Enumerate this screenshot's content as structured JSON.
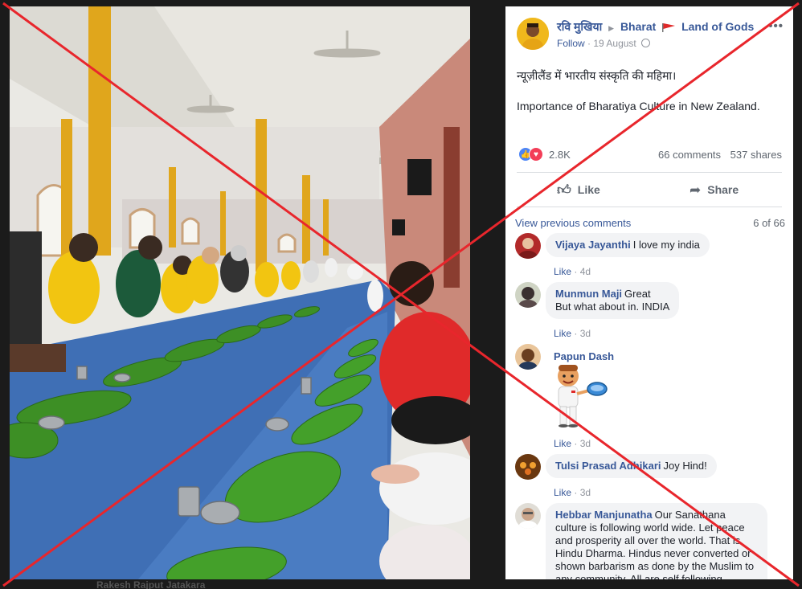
{
  "post": {
    "author": "रवि मुखिया",
    "group": "Bharat",
    "group_suffix": "Land of Gods",
    "follow": "Follow",
    "date": "19 August",
    "text_hindi": "न्यूज़ीलैंड में भारतीय संस्कृति की महिमा।",
    "text_english": "Importance of Bharatiya Culture in New Zealand.",
    "more_icon": "more-options-icon"
  },
  "reactions": {
    "count": "2.8K",
    "comments": "66 comments",
    "shares": "537 shares"
  },
  "actions": {
    "like": "Like",
    "share": "Share"
  },
  "comments_header": {
    "view_previous": "View previous comments",
    "count": "6 of 66"
  },
  "comments": [
    {
      "name": "Vijaya Jayanthi",
      "text": "I love my india",
      "like": "Like",
      "time": "4d"
    },
    {
      "name": "Munmun Maji",
      "text": "Great",
      "text2": "But what about in. INDIA",
      "like": "Like",
      "time": "3d"
    },
    {
      "name": "Papun Dash",
      "text": "",
      "like": "Like",
      "time": "3d"
    },
    {
      "name": "Tulsi Prasad Adhikari",
      "text": "Joy Hind!",
      "like": "Like",
      "time": "3d"
    },
    {
      "name": "Hebbar Manjunatha",
      "text": "Our Sanathana culture is following world wide. Let peace and prosperity all over the world. That is Hindu Dharma. Hindus never converted or shown barbarism as done by the Muslim to any community. All are self following"
    }
  ],
  "below_caption": "Rakesh Rajput Jatakara",
  "colors": {
    "fb_link": "#385898",
    "cross": "#e8262c",
    "background": "#1b1b1b"
  }
}
